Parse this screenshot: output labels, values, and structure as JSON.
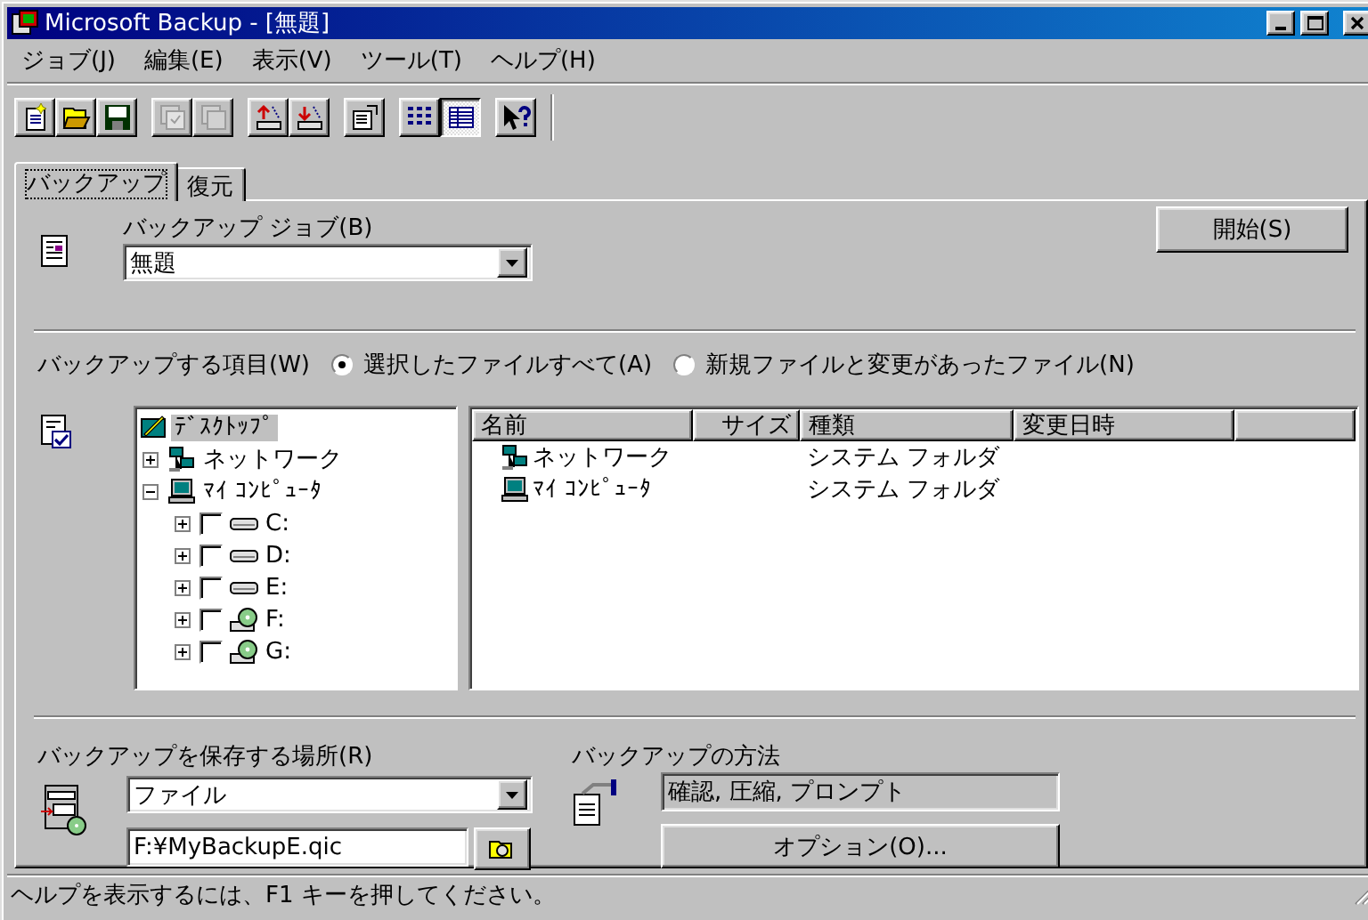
{
  "window": {
    "title": "Microsoft Backup - [無題]"
  },
  "menu": [
    {
      "label": "ジョブ(J)"
    },
    {
      "label": "編集(E)"
    },
    {
      "label": "表示(V)"
    },
    {
      "label": "ツール(T)"
    },
    {
      "label": "ヘルプ(H)"
    }
  ],
  "toolbar": {
    "groups": [
      [
        {
          "kind": "new",
          "disabled": false,
          "pressed": false
        },
        {
          "kind": "open",
          "disabled": false,
          "pressed": false
        },
        {
          "kind": "save",
          "disabled": false,
          "pressed": false
        }
      ],
      [
        {
          "kind": "select",
          "disabled": true,
          "pressed": false
        },
        {
          "kind": "copy",
          "disabled": true,
          "pressed": false
        }
      ],
      [
        {
          "kind": "backup",
          "disabled": false,
          "pressed": false
        },
        {
          "kind": "restore",
          "disabled": false,
          "pressed": false
        }
      ],
      [
        {
          "kind": "properties",
          "disabled": false,
          "pressed": false
        }
      ],
      [
        {
          "kind": "list",
          "disabled": false,
          "pressed": false
        },
        {
          "kind": "details",
          "disabled": false,
          "pressed": true
        }
      ],
      [
        {
          "kind": "help",
          "disabled": false,
          "pressed": false
        }
      ]
    ]
  },
  "tabs": [
    {
      "label": "バックアップ",
      "selected": true
    },
    {
      "label": "復元",
      "selected": false
    }
  ],
  "job": {
    "label": "バックアップ ジョブ(B)",
    "value": "無題"
  },
  "start_button": "開始(S)",
  "items": {
    "label": "バックアップする項目(W)",
    "options": [
      {
        "label": "選択したファイルすべて(A)",
        "selected": true
      },
      {
        "label": "新規ファイルと変更があったファイル(N)",
        "selected": false
      }
    ]
  },
  "tree": [
    {
      "kind": "desktop",
      "label": "ﾃﾞｽｸﾄｯﾌﾟ",
      "selected": true,
      "children": [
        {
          "kind": "network",
          "label": "ネットワーク",
          "selected": false,
          "expanded": false
        },
        {
          "kind": "computer",
          "label": "ﾏｲ ｺﾝﾋﾟｭｰﾀ",
          "selected": false,
          "expanded": true,
          "children": [
            {
              "kind": "drive",
              "label": "C:",
              "selected": false,
              "expanded": false,
              "checked": false
            },
            {
              "kind": "drive",
              "label": "D:",
              "selected": false,
              "expanded": false,
              "checked": false
            },
            {
              "kind": "drive",
              "label": "E:",
              "selected": false,
              "expanded": false,
              "checked": false
            },
            {
              "kind": "cd",
              "label": "F:",
              "selected": false,
              "expanded": false,
              "checked": false
            },
            {
              "kind": "cd",
              "label": "G:",
              "selected": false,
              "expanded": false,
              "checked": false
            }
          ]
        }
      ]
    }
  ],
  "list": {
    "columns": [
      "名前",
      "サイズ",
      "種類",
      "変更日時"
    ],
    "rows": [
      {
        "kind": "network",
        "name": "ネットワーク",
        "type": "システム フォルダ"
      },
      {
        "kind": "computer",
        "name": "ﾏｲ ｺﾝﾋﾟｭｰﾀ",
        "type": "システム フォルダ"
      }
    ]
  },
  "destination": {
    "label": "バックアップを保存する場所(R)",
    "type": "ファイル",
    "path": "F:¥MyBackupE.qic"
  },
  "method": {
    "label": "バックアップの方法",
    "value": "確認, 圧縮, プロンプト",
    "button": "オプション(O)..."
  },
  "status_bar": "ヘルプを表示するには、F1 キーを押してください。"
}
